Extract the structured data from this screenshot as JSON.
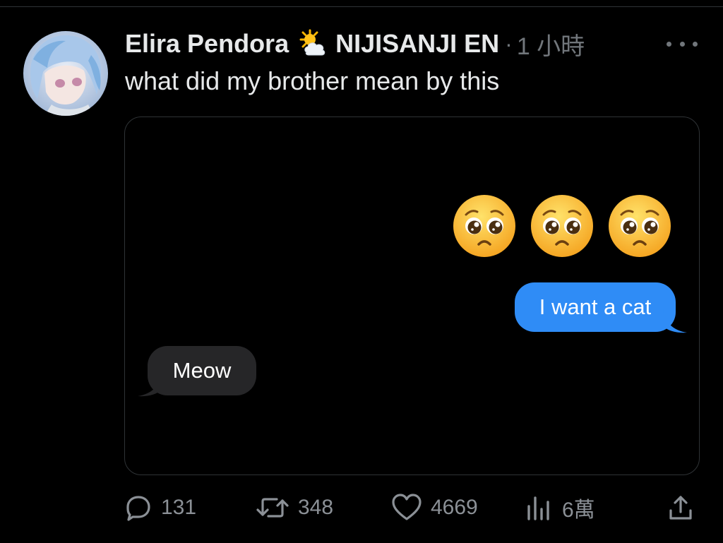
{
  "tweet": {
    "author": {
      "display_name": "Elira Pendora",
      "badge_icon": "sun-behind-cloud-icon",
      "affiliation": "NIJISANJI EN"
    },
    "separator": "·",
    "timestamp": "1 小時",
    "more_icon": "ellipsis-icon",
    "text": "what did my brother mean by this"
  },
  "media": {
    "emojis": [
      "pleading-face-icon",
      "pleading-face-icon",
      "pleading-face-icon"
    ],
    "messages": [
      {
        "direction": "outgoing",
        "text": "I want a cat"
      },
      {
        "direction": "incoming",
        "text": "Meow"
      }
    ]
  },
  "actions": {
    "reply": {
      "icon": "reply-bubble-icon",
      "count": "131"
    },
    "retweet": {
      "icon": "retweet-icon",
      "count": "348"
    },
    "like": {
      "icon": "heart-icon",
      "count": "4669"
    },
    "views": {
      "icon": "views-chart-icon",
      "count": "6萬"
    },
    "share": {
      "icon": "share-icon"
    }
  },
  "colors": {
    "background": "#000000",
    "text_primary": "#e7e9ea",
    "text_secondary": "#71767b",
    "outgoing_bubble": "#2f8cf6",
    "incoming_bubble": "#262628",
    "border": "#2f3336"
  }
}
